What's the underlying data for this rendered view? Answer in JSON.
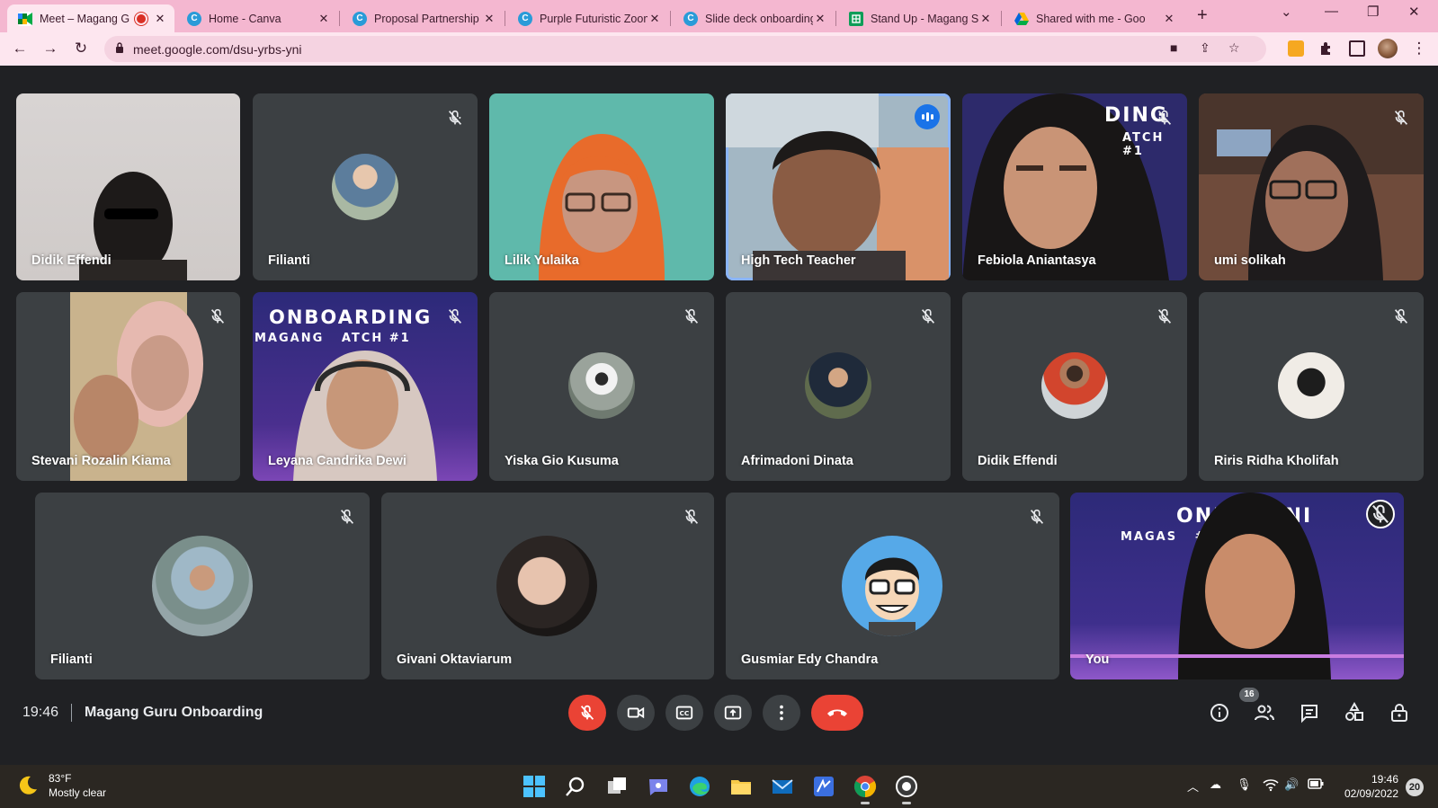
{
  "browser": {
    "tabs": [
      {
        "title": "Meet – Magang G",
        "favicon": "meet-icon",
        "recording": true
      },
      {
        "title": "Home - Canva",
        "favicon": "canva-icon"
      },
      {
        "title": "Proposal Partnership",
        "favicon": "canva-icon"
      },
      {
        "title": "Purple Futuristic Zoom",
        "favicon": "canva-icon"
      },
      {
        "title": "Slide deck onboarding",
        "favicon": "canva-icon"
      },
      {
        "title": "Stand Up - Magang S",
        "favicon": "sheets-icon"
      },
      {
        "title": "Shared with me - Goo",
        "favicon": "drive-icon"
      }
    ],
    "url": "meet.google.com/dsu-yrbs-yni",
    "colors": {
      "tabbar": "#f4b7d0",
      "toolbar": "#fde6ef",
      "omnibox": "#f5d3e1"
    }
  },
  "meet": {
    "participants": [
      {
        "name": "Didik Effendi",
        "muted": false,
        "camera": "video"
      },
      {
        "name": "Filianti",
        "muted": true,
        "camera": "avatar"
      },
      {
        "name": "Lilik Yulaika",
        "muted": false,
        "camera": "video"
      },
      {
        "name": "High Tech Teacher",
        "muted": false,
        "camera": "video",
        "speaking": true
      },
      {
        "name": "Febiola Aniantasya",
        "muted": true,
        "camera": "video"
      },
      {
        "name": "umi solikah",
        "muted": true,
        "camera": "video"
      },
      {
        "name": "Stevani Rozalin Kiama",
        "muted": true,
        "camera": "video"
      },
      {
        "name": "Leyana Candrika Dewi",
        "muted": true,
        "camera": "video"
      },
      {
        "name": "Yiska Gio Kusuma",
        "muted": true,
        "camera": "avatar"
      },
      {
        "name": "Afrimadoni Dinata",
        "muted": true,
        "camera": "avatar"
      },
      {
        "name": "Didik Effendi",
        "muted": true,
        "camera": "avatar"
      },
      {
        "name": "Riris Ridha Kholifah",
        "muted": true,
        "camera": "avatar"
      },
      {
        "name": "Filianti",
        "muted": true,
        "camera": "avatar"
      },
      {
        "name": "Givani Oktaviarum",
        "muted": true,
        "camera": "avatar"
      },
      {
        "name": "Gusmiar Edy Chandra",
        "muted": true,
        "camera": "avatar"
      },
      {
        "name": "You",
        "muted": true,
        "camera": "video",
        "self": true
      }
    ],
    "banner_texts": {
      "febiola": "DING",
      "febiola_sub": "ATCH #1",
      "leyana": "ONBOARDING",
      "leyana_sub": "MAGANG   ATCH #1",
      "self": "ONIG   DNI",
      "self_sub": "MAGAS   #1 HOTE"
    },
    "time": "19:46",
    "meeting_name": "Magang Guru Onboarding",
    "people_count": "16",
    "colors": {
      "background": "#202124",
      "tile": "#3c4043",
      "end_call": "#ea4335",
      "speaking": "#8ab4f8"
    }
  },
  "taskbar": {
    "weather_temp": "83°F",
    "weather_desc": "Mostly clear",
    "clock_time": "19:46",
    "clock_date": "02/09/2022",
    "notifications": "20"
  }
}
